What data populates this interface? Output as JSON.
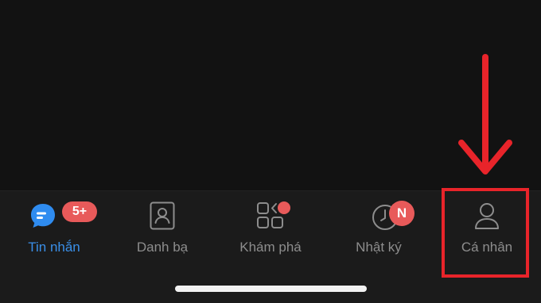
{
  "tabs": [
    {
      "id": "messages",
      "label": "Tin nhắn",
      "icon": "chat-bubble-icon",
      "badge": "5+",
      "active": true
    },
    {
      "id": "contacts",
      "label": "Danh bạ",
      "icon": "contact-card-icon",
      "badge": null,
      "active": false
    },
    {
      "id": "discover",
      "label": "Khám phá",
      "icon": "apps-grid-icon",
      "badge": null,
      "dot": true,
      "active": false
    },
    {
      "id": "timeline",
      "label": "Nhật ký",
      "icon": "clock-icon",
      "badge": "N",
      "active": false
    },
    {
      "id": "profile",
      "label": "Cá nhân",
      "icon": "person-icon",
      "badge": null,
      "active": false
    }
  ],
  "colors": {
    "active": "#3a8fe8",
    "inactive": "#8d8d8d",
    "badge": "#e85a5a",
    "annotation": "#e8242a",
    "background": "#121212",
    "tabbar": "#1b1b1b"
  }
}
